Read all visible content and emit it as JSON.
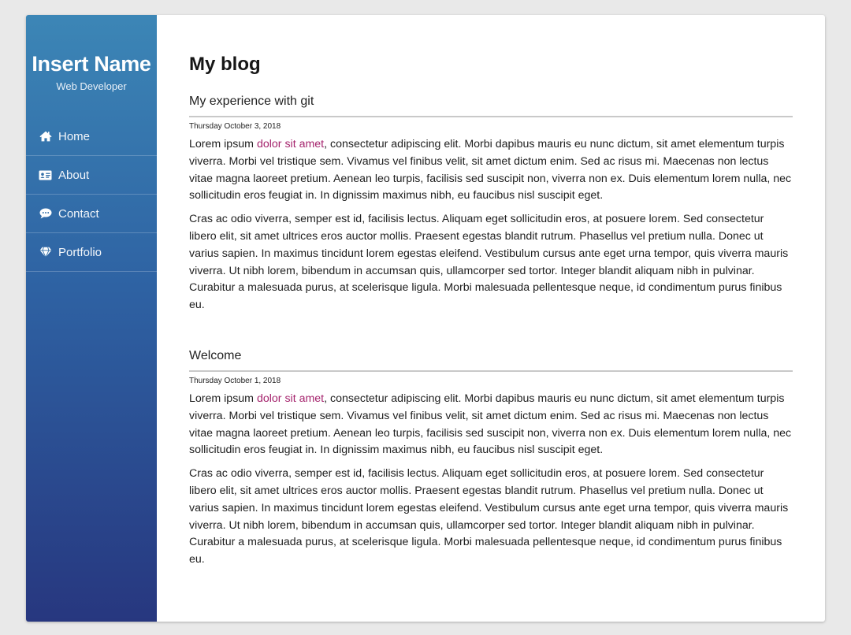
{
  "sidebar": {
    "name": "Insert Name",
    "role": "Web Developer",
    "items": [
      {
        "label": "Home",
        "icon": "home-icon"
      },
      {
        "label": "About",
        "icon": "id-card-icon"
      },
      {
        "label": "Contact",
        "icon": "chat-bubble-icon"
      },
      {
        "label": "Portfolio",
        "icon": "diamond-icon"
      }
    ]
  },
  "main": {
    "title": "My blog",
    "posts": [
      {
        "title": "My experience with git",
        "date": "Thursday October 3, 2018",
        "para1_before": "Lorem ipsum ",
        "para1_link": "dolor sit amet",
        "para1_after": ", consectetur adipiscing elit. Morbi dapibus mauris eu nunc dictum, sit amet elementum turpis viverra. Morbi vel tristique sem. Vivamus vel finibus velit, sit amet dictum enim. Sed ac risus mi. Maecenas non lectus vitae magna laoreet pretium. Aenean leo turpis, facilisis sed suscipit non, viverra non ex. Duis elementum lorem nulla, nec sollicitudin eros feugiat in. In dignissim maximus nibh, eu faucibus nisl suscipit eget.",
        "para2": "Cras ac odio viverra, semper est id, facilisis lectus. Aliquam eget sollicitudin eros, at posuere lorem. Sed consectetur libero elit, sit amet ultrices eros auctor mollis. Praesent egestas blandit rutrum. Phasellus vel pretium nulla. Donec ut varius sapien. In maximus tincidunt lorem egestas eleifend. Vestibulum cursus ante eget urna tempor, quis viverra mauris viverra. Ut nibh lorem, bibendum in accumsan quis, ullamcorper sed tortor. Integer blandit aliquam nibh in pulvinar. Curabitur a malesuada purus, at scelerisque ligula. Morbi malesuada pellentesque neque, id condimentum purus finibus eu."
      },
      {
        "title": "Welcome",
        "date": "Thursday October 1, 2018",
        "para1_before": "Lorem ipsum ",
        "para1_link": "dolor sit amet",
        "para1_after": ", consectetur adipiscing elit. Morbi dapibus mauris eu nunc dictum, sit amet elementum turpis viverra. Morbi vel tristique sem. Vivamus vel finibus velit, sit amet dictum enim. Sed ac risus mi. Maecenas non lectus vitae magna laoreet pretium. Aenean leo turpis, facilisis sed suscipit non, viverra non ex. Duis elementum lorem nulla, nec sollicitudin eros feugiat in. In dignissim maximus nibh, eu faucibus nisl suscipit eget.",
        "para2": "Cras ac odio viverra, semper est id, facilisis lectus. Aliquam eget sollicitudin eros, at posuere lorem. Sed consectetur libero elit, sit amet ultrices eros auctor mollis. Praesent egestas blandit rutrum. Phasellus vel pretium nulla. Donec ut varius sapien. In maximus tincidunt lorem egestas eleifend. Vestibulum cursus ante eget urna tempor, quis viverra mauris viverra. Ut nibh lorem, bibendum in accumsan quis, ullamcorper sed tortor. Integer blandit aliquam nibh in pulvinar. Curabitur a malesuada purus, at scelerisque ligula. Morbi malesuada pellentesque neque, id condimentum purus finibus eu."
      }
    ]
  },
  "colors": {
    "link": "#a5246d",
    "sidebar_top": "#3c86b6",
    "sidebar_bottom": "#27377f",
    "page_background": "#e9e9e9"
  }
}
